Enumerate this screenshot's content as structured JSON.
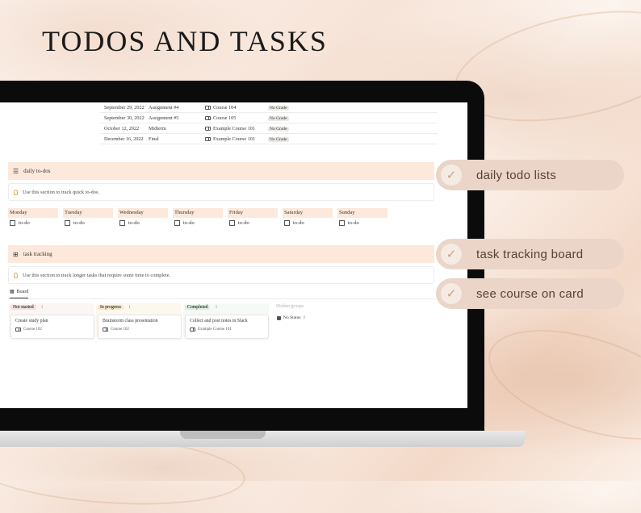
{
  "title": "TODOS AND TASKS",
  "assignments": [
    {
      "date": "September 29, 2022",
      "name": "Assignment #4",
      "course": "Course 104",
      "grade": "No Grade"
    },
    {
      "date": "September 30, 2022",
      "name": "Assignment #5",
      "course": "Course 105",
      "grade": "No Grade"
    },
    {
      "date": "October 12, 2022",
      "name": "Midterm",
      "course": "Example Course 101",
      "grade": "No Grade"
    },
    {
      "date": "December 16, 2022",
      "name": "Final",
      "course": "Example Course 101",
      "grade": "No Grade"
    }
  ],
  "daily": {
    "heading": "daily to-dos",
    "callout": "Use this section to track quick to-dos.",
    "days": [
      {
        "name": "Monday",
        "todo": "to-do"
      },
      {
        "name": "Tuesday",
        "todo": "to-do"
      },
      {
        "name": "Wednesday",
        "todo": "to-do"
      },
      {
        "name": "Thursday",
        "todo": "to-do"
      },
      {
        "name": "Friday",
        "todo": "to-do"
      },
      {
        "name": "Saturday",
        "todo": "to-do"
      },
      {
        "name": "Sunday",
        "todo": "to-do"
      }
    ]
  },
  "tasks": {
    "heading": "task tracking",
    "callout": "Use this section to track longer tasks that require some time to complete.",
    "view_tab": "Board",
    "columns": [
      {
        "status": "Not started",
        "count": "1",
        "pill_bg": "#f5e0dc",
        "bg": "#fbf6f4",
        "card_title": "Create study plan",
        "card_course": "Course 102"
      },
      {
        "status": "In progress",
        "count": "1",
        "pill_bg": "#fae6c8",
        "bg": "#fdf8ef",
        "card_title": "Brainstorm class presentation",
        "card_course": "Course 102"
      },
      {
        "status": "Completed",
        "count": "1",
        "pill_bg": "#dbeedc",
        "bg": "#f6faf6",
        "card_title": "Collect and post notes in Slack",
        "card_course": "Example Course 101"
      }
    ],
    "hidden_groups": "Hidden groups",
    "no_status": "No Status",
    "no_status_count": "0"
  },
  "features": [
    {
      "label": "daily todo lists",
      "icon": "check-icon"
    },
    {
      "label": "task tracking board",
      "icon": "check-icon"
    },
    {
      "label": "see course on card",
      "icon": "check-icon"
    }
  ],
  "colors": {
    "accent_peach": "#fde9db",
    "pill": "#ead5c8",
    "check": "#c89f87"
  }
}
